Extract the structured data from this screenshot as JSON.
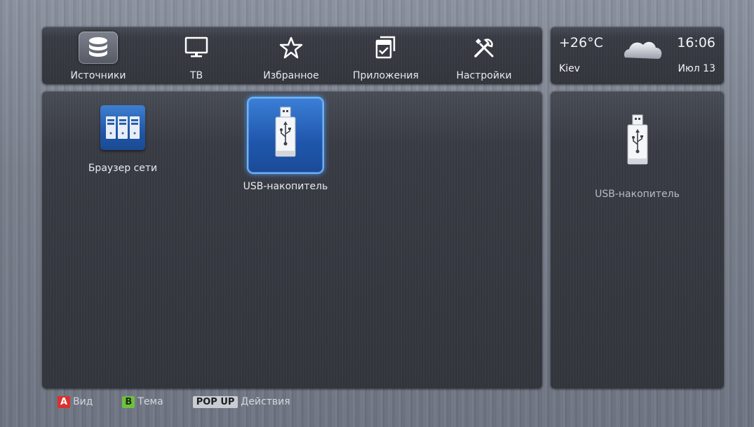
{
  "nav": {
    "items": [
      {
        "label": "Источники",
        "icon": "database-icon",
        "active": true
      },
      {
        "label": "ТВ",
        "icon": "monitor-icon",
        "active": false
      },
      {
        "label": "Избранное",
        "icon": "star-icon",
        "active": false
      },
      {
        "label": "Приложения",
        "icon": "apps-icon",
        "active": false
      },
      {
        "label": "Настройки",
        "icon": "tools-icon",
        "active": false
      }
    ]
  },
  "info": {
    "temperature": "+26°C",
    "time": "16:06",
    "city": "Kiev",
    "date": "Июл 13",
    "weather_icon": "cloud-icon"
  },
  "sources": [
    {
      "label": "Браузер сети",
      "icon": "network-servers-icon",
      "selected": false
    },
    {
      "label": "USB-накопитель",
      "icon": "usb-drive-icon",
      "selected": true
    }
  ],
  "preview": {
    "label": "USB-накопитель",
    "icon": "usb-drive-icon"
  },
  "footer": {
    "items": [
      {
        "key": "A",
        "label": "Вид",
        "color": "#d8322e"
      },
      {
        "key": "B",
        "label": "Тема",
        "color": "#6fbf3f"
      },
      {
        "key": "POP UP",
        "label": "Действия",
        "color": "#c9ccd1"
      }
    ]
  },
  "colors": {
    "accent": "#3b7fd6",
    "selection_glow": "#6cb4ff"
  }
}
